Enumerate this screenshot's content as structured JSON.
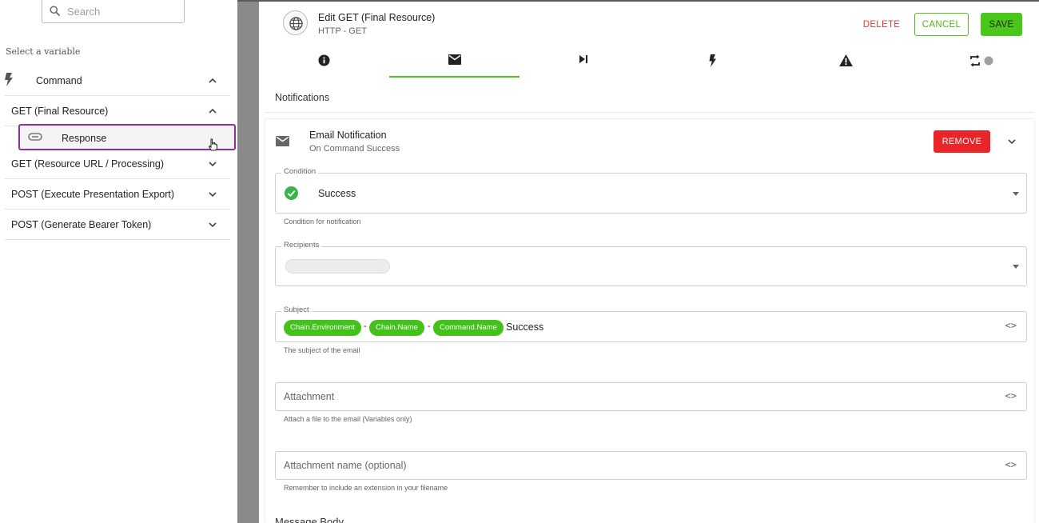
{
  "left_panel": {
    "search_placeholder": "Search",
    "select_label": "Select a variable",
    "groups": [
      {
        "label": "Command"
      },
      {
        "label": "GET (Final Resource)",
        "children": [
          {
            "label": "Response"
          }
        ]
      },
      {
        "label": "GET (Resource URL / Processing)"
      },
      {
        "label": "POST (Execute Presentation Export)"
      },
      {
        "label": "POST (Generate Bearer Token)"
      }
    ]
  },
  "dialog": {
    "title": "Edit GET (Final Resource)",
    "subtitle": "HTTP - GET",
    "buttons": {
      "delete": "DELETE",
      "cancel": "CANCEL",
      "save": "SAVE"
    },
    "tabs": [
      {
        "icon": "info-icon"
      },
      {
        "icon": "mail-icon",
        "active": true
      },
      {
        "icon": "skip-next-icon"
      },
      {
        "icon": "flash-icon"
      },
      {
        "icon": "warning-icon"
      },
      {
        "icon": "repeat-icon"
      }
    ],
    "section_title": "Notifications",
    "notification": {
      "title": "Email Notification",
      "subtitle": "On Command Success",
      "remove_label": "REMOVE",
      "condition": {
        "legend": "Condition",
        "value": "Success",
        "helper": "Condition for notification"
      },
      "recipients": {
        "legend": "Recipients"
      },
      "subject": {
        "legend": "Subject",
        "chips": [
          "Chain.Environment",
          "Chain.Name",
          "Command.Name"
        ],
        "separator": "-",
        "tail": "Success",
        "helper": "The subject of the email"
      },
      "attachment": {
        "placeholder": "Attachment",
        "helper": "Attach a file to the email (Variables only)"
      },
      "attachment_name": {
        "placeholder": "Attachment name (optional)",
        "helper": "Remember to include an extension in your filename"
      },
      "message_body_label": "Message Body"
    }
  },
  "colors": {
    "accent_green": "#4bc61b",
    "danger_red": "#e8262a",
    "highlight_purple": "#8e2fa1",
    "overlay_gray": "#8a8a8a"
  }
}
